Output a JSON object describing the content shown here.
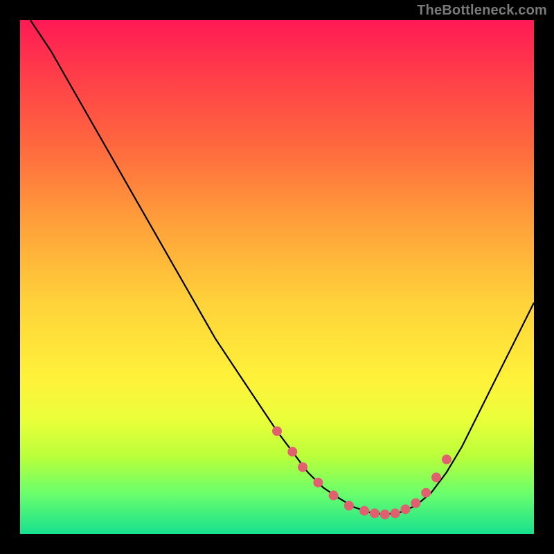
{
  "watermark": "TheBottleneck.com",
  "colors": {
    "background": "#000000",
    "curve_stroke": "#000000",
    "dot_fill": "#e06070",
    "gradient_top": "#ff1a55",
    "gradient_bottom": "#17e08e"
  },
  "chart_data": {
    "type": "line",
    "title": "",
    "xlabel": "",
    "ylabel": "",
    "xlim": [
      0,
      100
    ],
    "ylim": [
      0,
      100
    ],
    "grid": false,
    "series": [
      {
        "name": "bottleneck-curve",
        "x": [
          2,
          6,
          10,
          14,
          18,
          22,
          26,
          30,
          34,
          38,
          42,
          46,
          50,
          53,
          56,
          59,
          62,
          65,
          68,
          71,
          74,
          77,
          80,
          83,
          86,
          89,
          92,
          95,
          98,
          100
        ],
        "y": [
          100,
          94,
          87,
          80,
          73,
          66,
          59,
          52,
          45,
          38,
          32,
          26,
          20,
          16,
          12,
          9,
          7,
          5.2,
          4.2,
          3.8,
          4.2,
          5.5,
          8,
          12,
          17,
          23,
          29,
          35,
          41,
          45
        ]
      }
    ],
    "dots": {
      "name": "highlight-dots",
      "x": [
        50,
        53,
        55,
        58,
        61,
        64,
        67,
        69,
        71,
        73,
        75,
        77,
        79,
        81,
        83
      ],
      "y": [
        20,
        16,
        13,
        10,
        7.5,
        5.5,
        4.5,
        4.0,
        3.8,
        4.0,
        4.8,
        6.0,
        8.0,
        11.0,
        14.5
      ]
    }
  }
}
